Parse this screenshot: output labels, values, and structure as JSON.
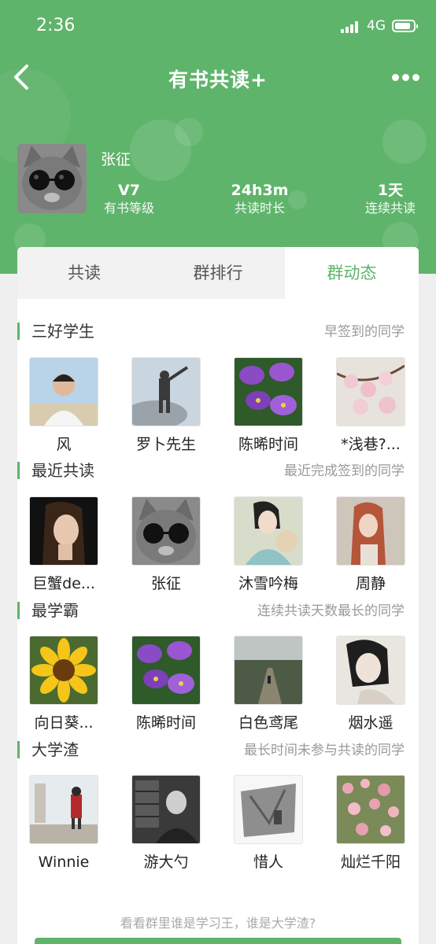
{
  "status_bar": {
    "time": "2:36",
    "network": "4G"
  },
  "nav": {
    "title": "有书共读+",
    "back_icon": "chevron-left-icon",
    "more_icon": "more-dots-icon"
  },
  "profile": {
    "name": "张征",
    "stats": [
      {
        "value": "V7",
        "label": "有书等级"
      },
      {
        "value": "24h3m",
        "label": "共读时长"
      },
      {
        "value": "1天",
        "label": "连续共读"
      }
    ]
  },
  "tabs": [
    {
      "label": "共读",
      "active": false
    },
    {
      "label": "群排行",
      "active": false
    },
    {
      "label": "群动态",
      "active": true
    }
  ],
  "sections": [
    {
      "title": "三好学生",
      "subtitle": "早签到的同学",
      "members": [
        {
          "name": "风",
          "avatar": "young-man-portrait"
        },
        {
          "name": "罗卜先生",
          "avatar": "man-on-rock"
        },
        {
          "name": "陈晞时间",
          "avatar": "purple-iris"
        },
        {
          "name": "*浅巷?...",
          "avatar": "cherry-blossom"
        }
      ]
    },
    {
      "title": "最近共读",
      "subtitle": "最近完成签到的同学",
      "members": [
        {
          "name": "巨蟹de...",
          "avatar": "woman-praying"
        },
        {
          "name": "张征",
          "avatar": "cat-sunglasses"
        },
        {
          "name": "沐雪吟梅",
          "avatar": "woman-fan"
        },
        {
          "name": "周静",
          "avatar": "red-hair-woman"
        }
      ]
    },
    {
      "title": "最学霸",
      "subtitle": "连续共读天数最长的同学",
      "members": [
        {
          "name": "向日葵...",
          "avatar": "sunflower"
        },
        {
          "name": "陈晞时间",
          "avatar": "purple-iris"
        },
        {
          "name": "白色鸢尾",
          "avatar": "forest-path"
        },
        {
          "name": "烟水遥",
          "avatar": "woman-portrait"
        }
      ]
    },
    {
      "title": "大学渣",
      "subtitle": "最长时间未参与共读的同学",
      "members": [
        {
          "name": "Winnie",
          "avatar": "woman-street"
        },
        {
          "name": "游大勺",
          "avatar": "old-man-library"
        },
        {
          "name": "惜人",
          "avatar": "sketch-art"
        },
        {
          "name": "灿烂千阳",
          "avatar": "pink-flowers"
        }
      ]
    }
  ],
  "footer": {
    "hint": "看看群里谁是学习王，谁是大学渣?"
  },
  "colors": {
    "accent": "#5fb46b",
    "subtext": "#999999"
  }
}
